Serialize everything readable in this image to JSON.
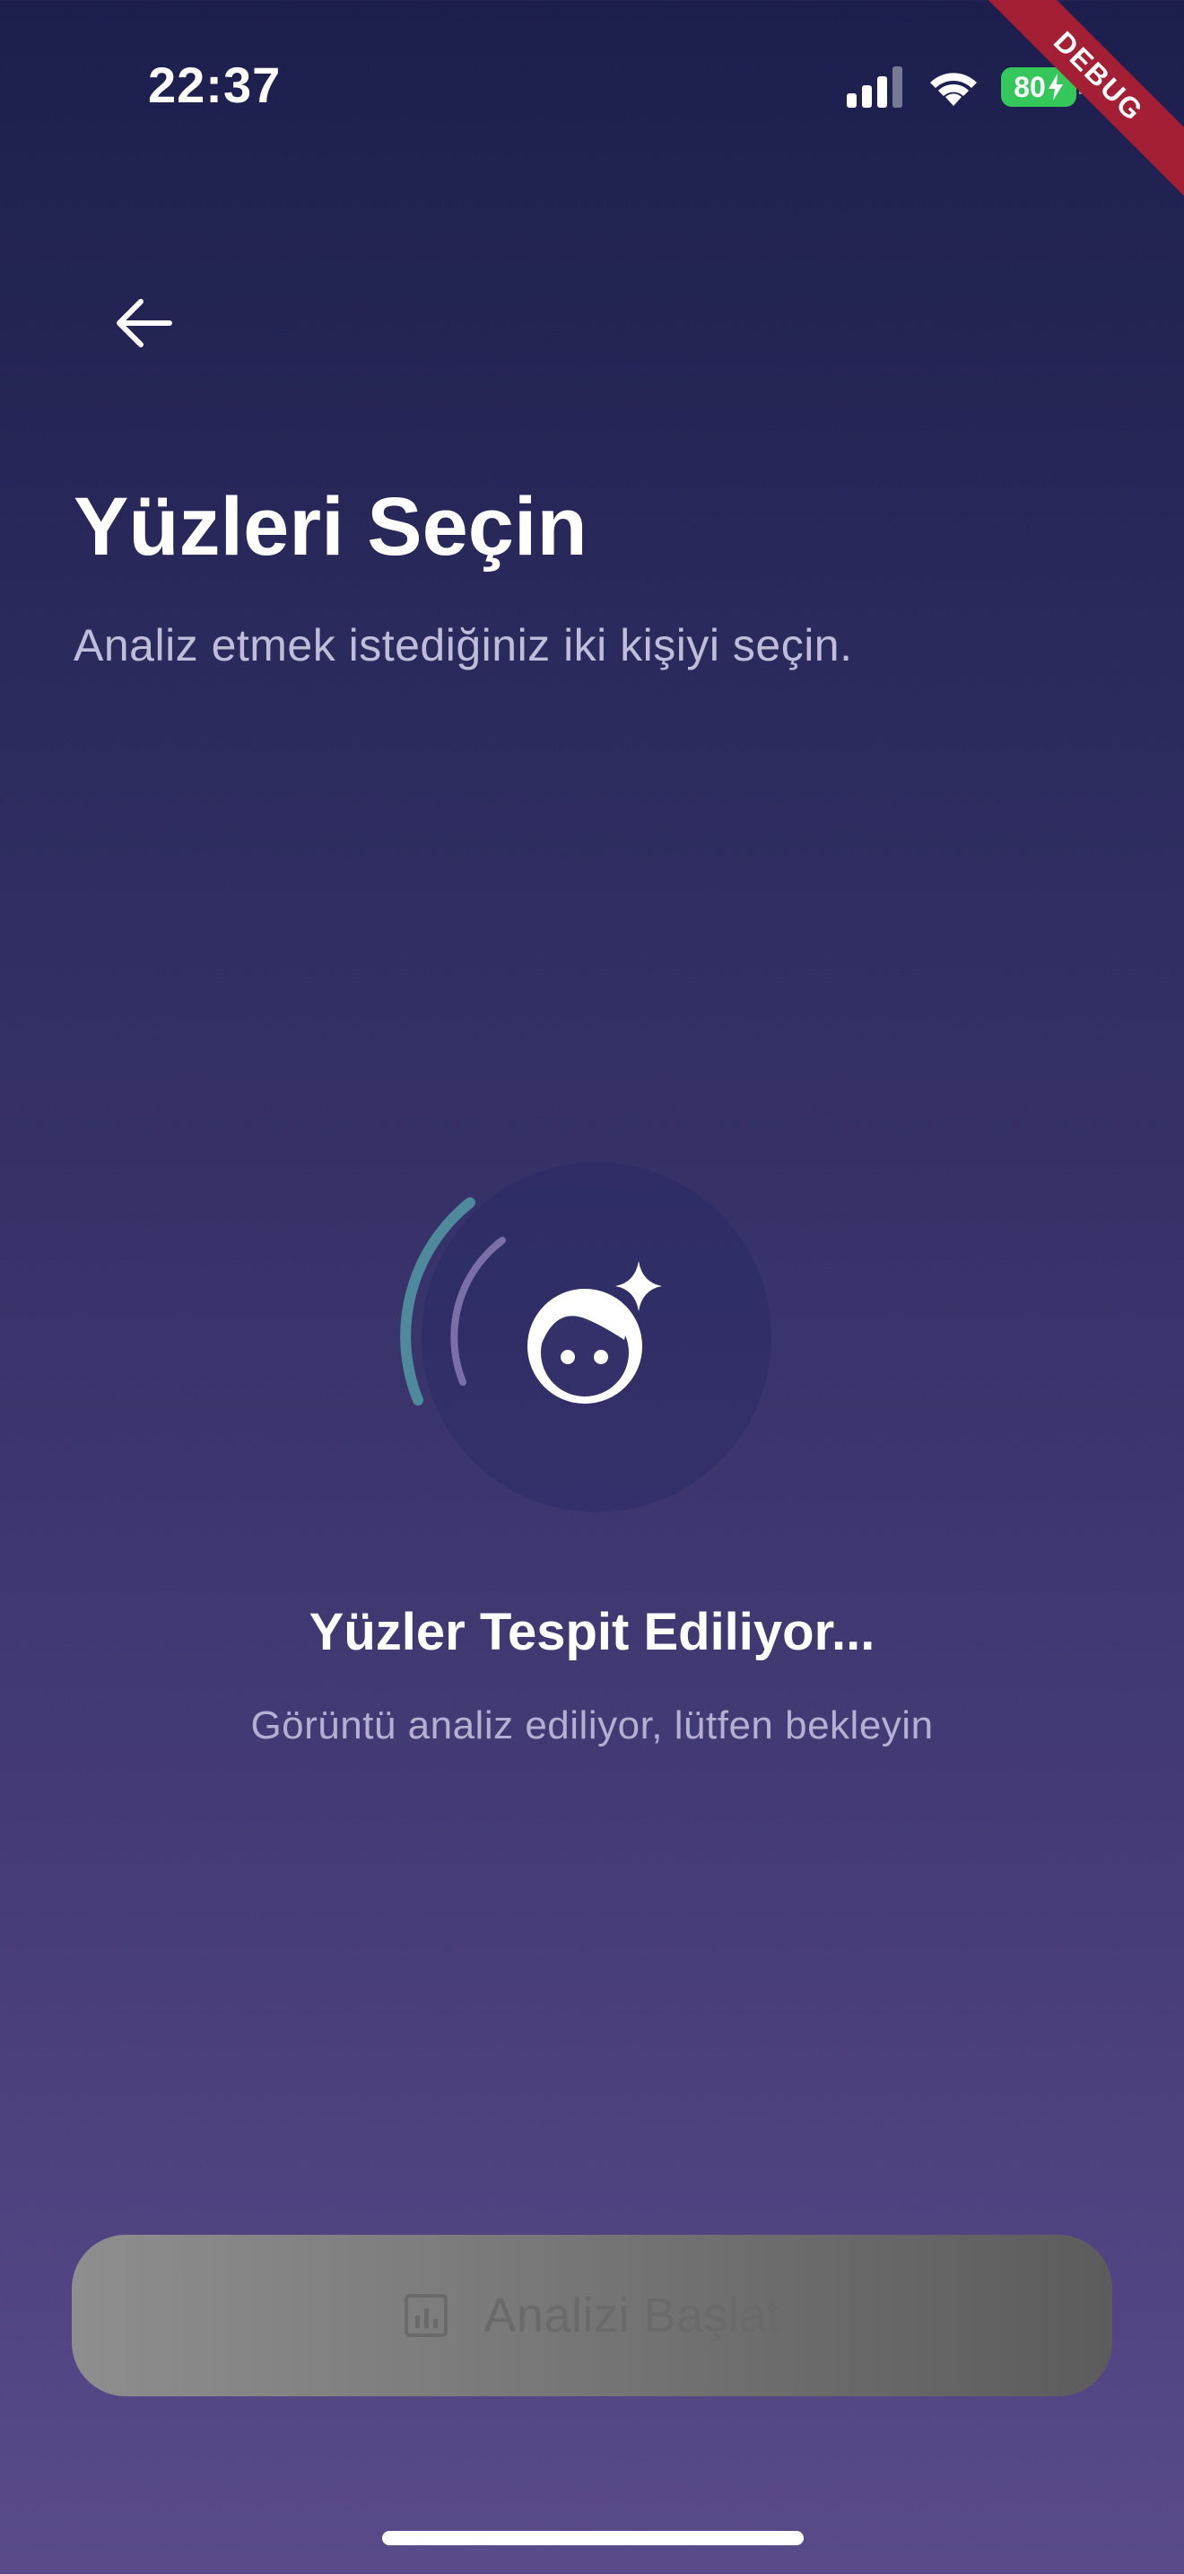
{
  "status_bar": {
    "time": "22:37",
    "battery": "80",
    "signal_icon": "cellular-signal-icon",
    "wifi_icon": "wifi-icon",
    "battery_icon": "battery-charging-icon"
  },
  "debug_banner": "DEBUG",
  "header": {
    "back_icon": "arrow-left-icon",
    "title": "Yüzleri Seçin",
    "subtitle": "Analiz etmek istediğiniz iki kişiyi seçin."
  },
  "loading": {
    "icon": "face-sparkle-icon",
    "title": "Yüzler Tespit Ediliyor...",
    "message": "Görüntü analiz ediliyor, lütfen bekleyin"
  },
  "action": {
    "icon": "bar-chart-icon",
    "label": "Analizi Başlat"
  },
  "colors": {
    "background_top": "#1c1f4d",
    "background_bottom": "#5a4a8a",
    "battery_green": "#34c759",
    "debug_red": "#a41e34",
    "spinner_teal": "#4f8a9c",
    "spinner_lavender": "#8d7fb8",
    "disabled_button": "#7a7a7a"
  }
}
